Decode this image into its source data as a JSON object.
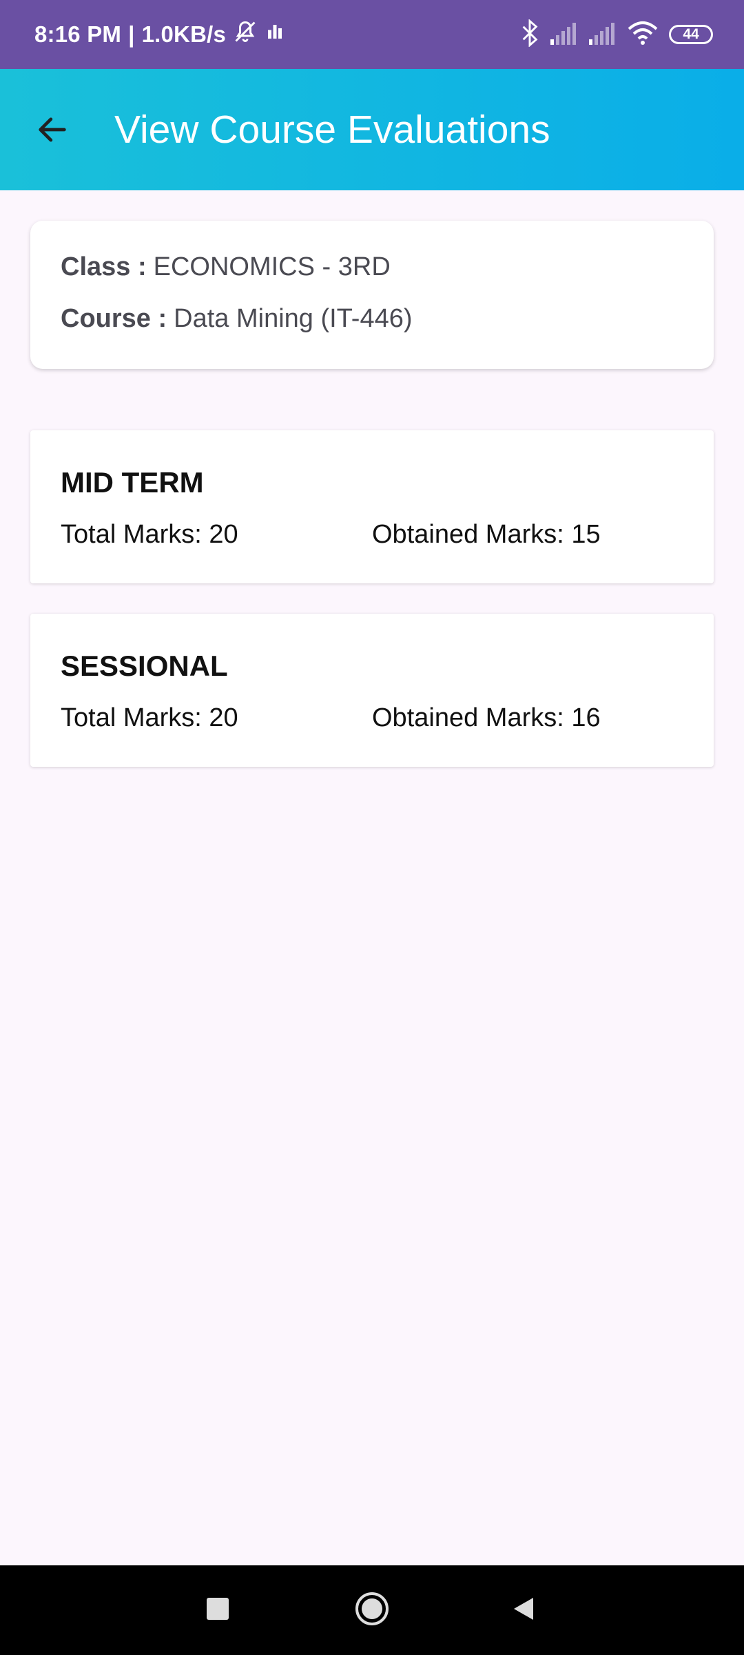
{
  "status_bar": {
    "time": "8:16 PM",
    "separator": "|",
    "net_speed": "1.0KB/s",
    "battery": "44",
    "icons": [
      "mute-icon",
      "activity-icon",
      "bluetooth-icon",
      "signal-icon",
      "signal-icon",
      "wifi-icon",
      "battery-icon"
    ]
  },
  "app_bar": {
    "title": "View Course Evaluations",
    "back_icon": "arrow-left-icon"
  },
  "info": {
    "class_label": "Class :",
    "class_value": "ECONOMICS - 3RD",
    "course_label": "Course :",
    "course_value": "Data Mining (IT-446)"
  },
  "evaluations": [
    {
      "name": "MID TERM",
      "total": "Total Marks: 20",
      "obtained": "Obtained Marks: 15"
    },
    {
      "name": "SESSIONAL",
      "total": "Total Marks: 20",
      "obtained": "Obtained Marks: 16"
    }
  ],
  "nav_bar": {
    "icons": [
      "recents-icon",
      "home-icon",
      "back-icon"
    ]
  },
  "colors": {
    "status_bar": "#6a50a3",
    "app_bar_start": "#1ac0d9",
    "app_bar_end": "#0aaee8",
    "background": "#fcf6fd"
  }
}
